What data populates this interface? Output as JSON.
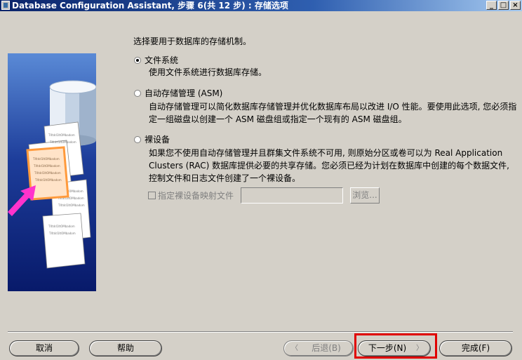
{
  "window": {
    "title": "Database Configuration Assistant, 步骤 6(共 12 步) : 存储选项",
    "controls": [
      "_",
      "□",
      "×"
    ]
  },
  "side_image": {
    "doc_text": "TXtdd1ItOMbadom"
  },
  "main": {
    "prompt": "选择要用于数据库的存储机制。",
    "options": [
      {
        "label": "文件系统",
        "selected": true,
        "description": [
          "使用文件系统进行数据库存储。"
        ]
      },
      {
        "label": "自动存储管理 (ASM)",
        "selected": false,
        "description": [
          "自动存储管理可以简化数据库存储管理并优化数据库布局以改进 I/O 性能。要使用此选项, 您必须指",
          "定一组磁盘以创建一个 ASM 磁盘组或指定一个现有的 ASM 磁盘组。"
        ]
      },
      {
        "label": "裸设备",
        "selected": false,
        "description": [
          "如果您不使用自动存储管理并且群集文件系统不可用, 则原始分区或卷可以为 Real Application",
          "Clusters (RAC) 数据库提供必要的共享存储。您必须已经为计划在数据库中创建的每个数据文件,",
          "控制文件和日志文件创建了一个裸设备。"
        ]
      }
    ],
    "raw_mapping": {
      "checkbox_label": "指定裸设备映射文件",
      "checked": false,
      "path_value": "",
      "browse_label": "浏览..."
    }
  },
  "footer": {
    "cancel": "取消",
    "help": "帮助",
    "back": "后退(B)",
    "next": "下一步(N)",
    "finish": "完成(F)"
  },
  "colors": {
    "highlight": "#e00000",
    "titlebar": "#0a246a",
    "side_panel": "#1d3d9a",
    "arrow": "#ff33cc"
  }
}
